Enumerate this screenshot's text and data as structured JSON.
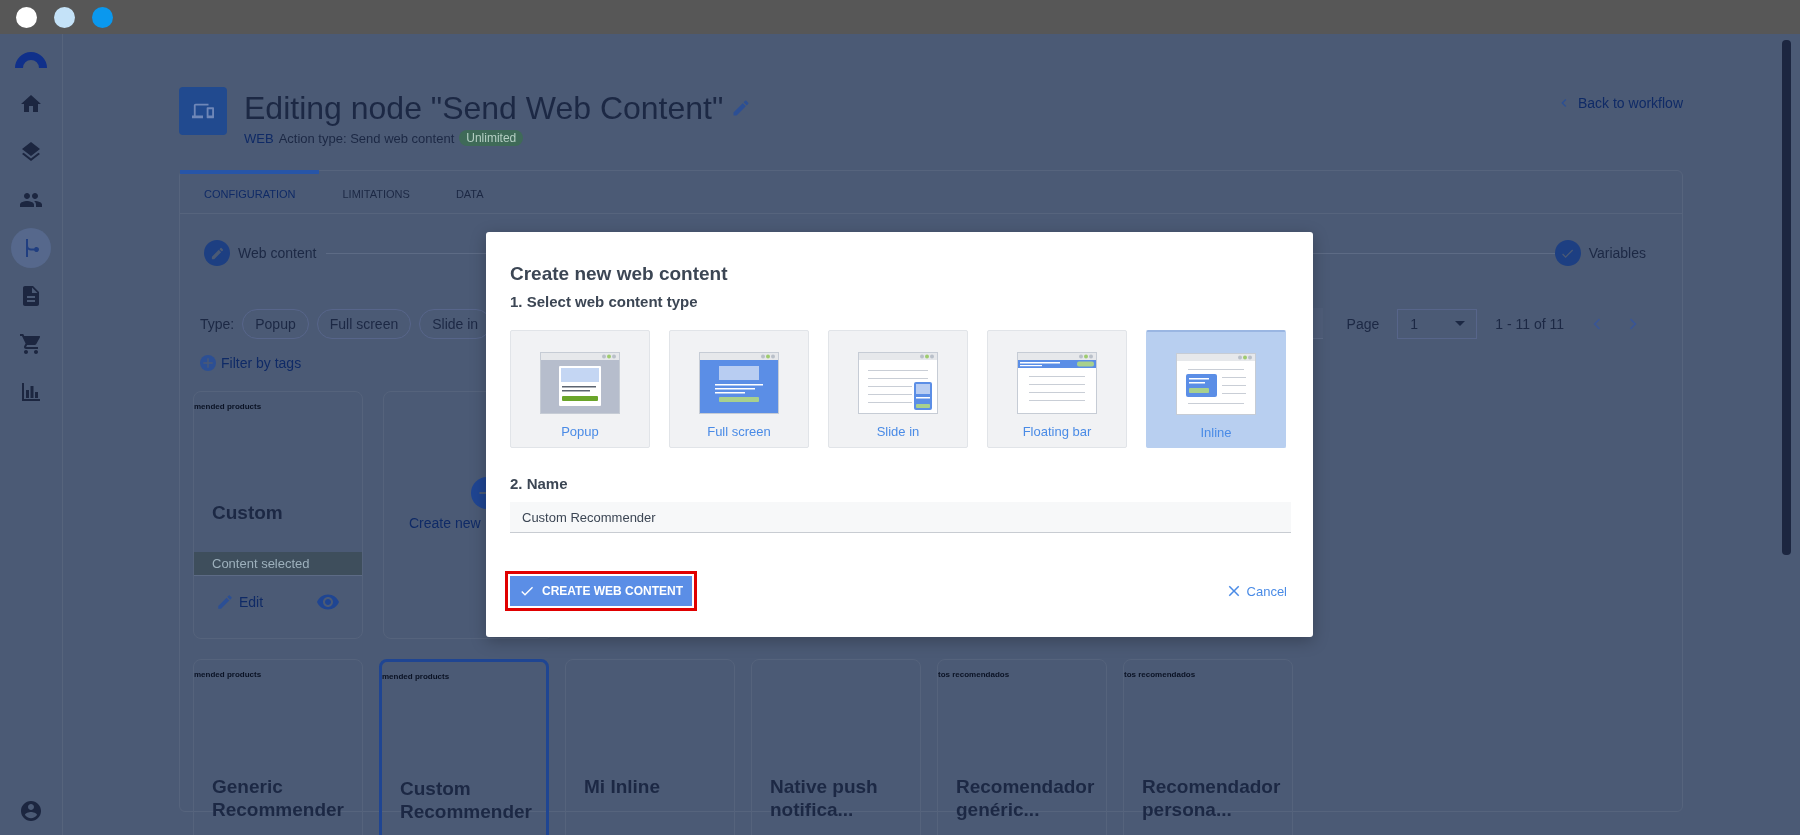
{
  "sidebar": {
    "items": [
      {
        "kind": "home",
        "selected": false
      },
      {
        "kind": "layers",
        "selected": false
      },
      {
        "kind": "people",
        "selected": false
      },
      {
        "kind": "branch",
        "selected": true
      },
      {
        "kind": "document",
        "selected": false
      },
      {
        "kind": "cart",
        "selected": false
      },
      {
        "kind": "chart",
        "selected": false
      }
    ]
  },
  "header": {
    "title": "Editing node \"Send Web Content\"",
    "channel": "WEB",
    "action_type": "Action type: Send web content",
    "badge": "Unlimited",
    "back_link": "Back to workflow"
  },
  "tabs": [
    {
      "label": "CONFIGURATION",
      "selected": true
    },
    {
      "label": "LIMITATIONS",
      "selected": false
    },
    {
      "label": "DATA",
      "selected": false
    }
  ],
  "stepper": [
    {
      "label": "Web content",
      "kind": "edit"
    },
    {
      "label": "Variables",
      "kind": "done"
    }
  ],
  "filters": {
    "type_label": "Type:",
    "chips": [
      "Popup",
      "Full screen",
      "Slide in"
    ],
    "filter_by_tags": "Filter by tags"
  },
  "pagination": {
    "page_label": "Page",
    "page": "1",
    "range": "1 - 11 of 11"
  },
  "featured_cards": [
    {
      "kind": "content",
      "preview_text": "mended products",
      "title": "Custom",
      "status": "Content selected",
      "edit": "Edit"
    },
    {
      "kind": "create",
      "label": "Create new"
    }
  ],
  "cards": [
    {
      "preview_text": "mended products",
      "title": "Generic Recommender",
      "selected": false
    },
    {
      "preview_text": "mended products",
      "title": "Custom Recommender",
      "selected": true
    },
    {
      "title": "Mi Inline",
      "selected": false
    },
    {
      "title": "Native push notifica...",
      "selected": false
    },
    {
      "preview_text": "tos recomendados",
      "title": "Recomendador genéric...",
      "selected": false
    },
    {
      "preview_text": "tos recomendados",
      "title": "Recomendador persona...",
      "selected": false
    }
  ],
  "dialog": {
    "title": "Create new web content",
    "step1": "1. Select web content type",
    "types": [
      {
        "label": "Popup",
        "kind": "popup",
        "selected": false
      },
      {
        "label": "Full screen",
        "kind": "fullscreen",
        "selected": false
      },
      {
        "label": "Slide in",
        "kind": "slidein",
        "selected": false
      },
      {
        "label": "Floating bar",
        "kind": "floatingbar",
        "selected": false
      },
      {
        "label": "Inline",
        "kind": "inline",
        "selected": true
      }
    ],
    "step2": "2. Name",
    "name_value": "Custom Recommender",
    "create_button": {
      "label": "CREATE WEB CONTENT",
      "highlighted": true
    },
    "cancel_button": "Cancel"
  }
}
